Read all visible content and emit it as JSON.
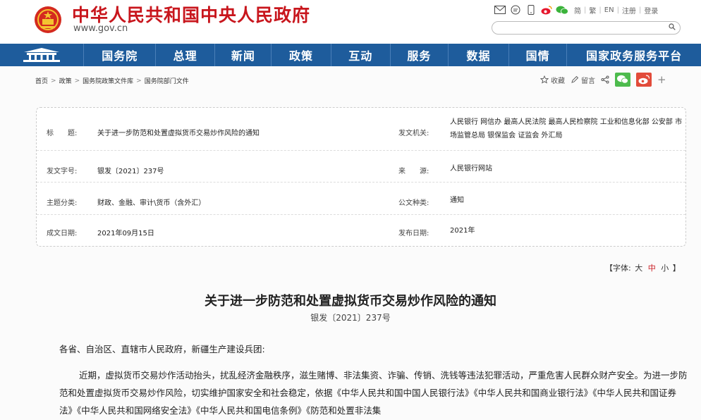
{
  "header": {
    "title": "中华人民共和国中央人民政府",
    "url": "www.gov.cn",
    "toolbar": [
      "简",
      "繁",
      "EN",
      "注册",
      "登录"
    ],
    "search": {
      "value": "",
      "placeholder": ""
    }
  },
  "nav": {
    "items": [
      "国务院",
      "总理",
      "新闻",
      "政策",
      "互动",
      "服务",
      "数据",
      "国情",
      "国家政务服务平台"
    ]
  },
  "breadcrumb": [
    "首页",
    "政策",
    "国务院政策文件库",
    "国务院部门文件"
  ],
  "actions": {
    "favorite": "收藏",
    "comment": "留言"
  },
  "info": {
    "title_label": "标　　题:",
    "title_value": "关于进一步防范和处置虚拟货币交易炒作风险的通知",
    "issuer_label": "发文机关:",
    "issuer_value": "人民银行 网信办 最高人民法院 最高人民检察院 工业和信息化部 公安部 市场监管总局 银保监会 证监会 外汇局",
    "docno_label": "发文字号:",
    "docno_value": "银发〔2021〕237号",
    "source_label": "来　　源:",
    "source_value": "人民银行网站",
    "topic_label": "主题分类:",
    "topic_value": "财政、金融、审计\\货币（含外汇）",
    "type_label": "公文种类:",
    "type_value": "通知",
    "written_label": "成文日期:",
    "written_value": "2021年09月15日",
    "published_label": "发布日期:",
    "published_value": "2021年"
  },
  "fontsize": {
    "prefix": "【字体:",
    "large": "大",
    "medium": "中",
    "small": "小",
    "suffix": "】"
  },
  "document": {
    "title": "关于进一步防范和处置虚拟货币交易炒作风险的通知",
    "number": "银发〔2021〕237号",
    "salutation": "各省、自治区、直辖市人民政府，新疆生产建设兵团:",
    "paragraph": "近期，虚拟货币交易炒作活动抬头，扰乱经济金融秩序，滋生赌博、非法集资、诈骗、传销、洗钱等违法犯罪活动，严重危害人民群众财产安全。为进一步防范和处置虚拟货币交易炒作风险，切实维护国家安全和社会稳定，依据《中华人民共和国中国人民银行法》《中华人民共和国商业银行法》《中华人民共和国证券法》《中华人民共和国网络安全法》《中华人民共和国电信条例》《防范和处置非法集"
  },
  "colors": {
    "brand_red": "#c8161d",
    "nav_blue": "#1e5c9c"
  }
}
